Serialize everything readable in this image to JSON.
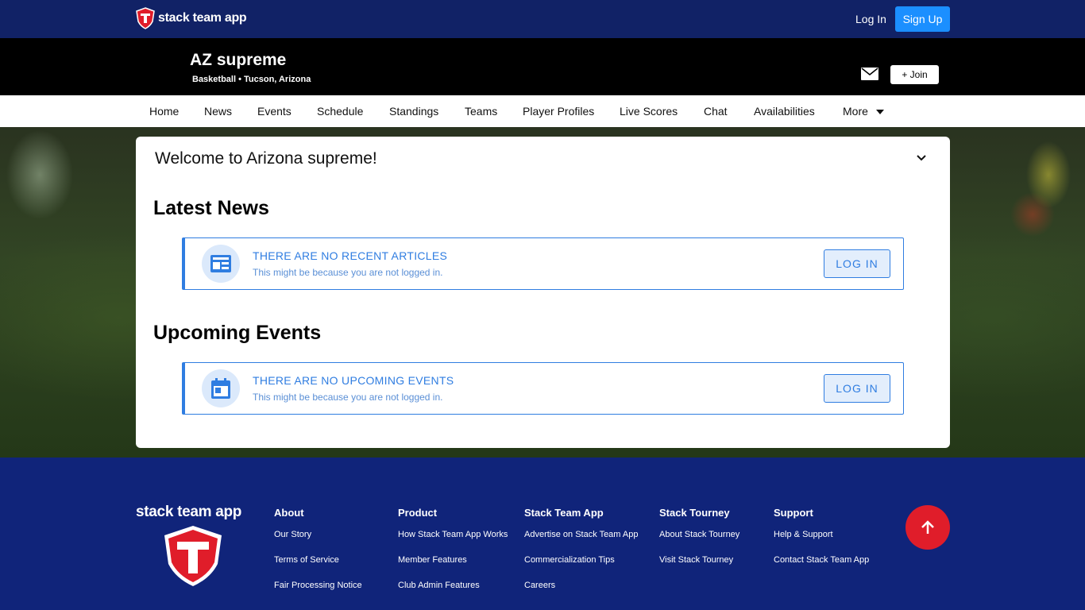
{
  "topbar": {
    "brand": "stack team app",
    "login": "Log In",
    "signup": "Sign Up"
  },
  "club": {
    "name": "AZ supreme",
    "subtitle": "Basketball • Tucson, Arizona",
    "join": "+ Join"
  },
  "nav": [
    "Home",
    "News",
    "Events",
    "Schedule",
    "Standings",
    "Teams",
    "Player Profiles",
    "Live Scores",
    "Chat",
    "Availabilities",
    "More"
  ],
  "main": {
    "welcome": "Welcome to Arizona supreme!",
    "news": {
      "title": "Latest News",
      "notice_title": "THERE ARE NO RECENT ARTICLES",
      "notice_sub": "This might be because you are not logged in.",
      "button": "LOG IN"
    },
    "events": {
      "title": "Upcoming Events",
      "notice_title": "THERE ARE NO UPCOMING EVENTS",
      "notice_sub": "This might be because you are not logged in.",
      "button": "LOG IN"
    }
  },
  "footer": {
    "brand": "stack team app",
    "columns": [
      {
        "title": "About",
        "links": [
          "Our Story",
          "Terms of Service",
          "Fair Processing Notice"
        ]
      },
      {
        "title": "Product",
        "links": [
          "How Stack Team App Works",
          "Member Features",
          "Club Admin Features"
        ]
      },
      {
        "title": "Stack Team App",
        "links": [
          "Advertise on Stack Team App",
          "Commercialization Tips",
          "Careers"
        ]
      },
      {
        "title": "Stack Tourney",
        "links": [
          "About Stack Tourney",
          "Visit Stack Tourney"
        ]
      },
      {
        "title": "Support",
        "links": [
          "Help & Support",
          "Contact Stack Team App"
        ]
      }
    ]
  },
  "colors": {
    "topbar": "#112266",
    "accent": "#1b8fff",
    "notice": "#2f7de1",
    "footer": "#10247a",
    "totop": "#e01d2a"
  },
  "icons": {
    "brand": "shield-logo-icon",
    "mail": "mail-icon",
    "more": "caret-down-icon",
    "collapse": "chevron-down-icon",
    "news": "newspaper-icon",
    "events": "calendar-icon",
    "scroll_top": "arrow-up-icon"
  }
}
